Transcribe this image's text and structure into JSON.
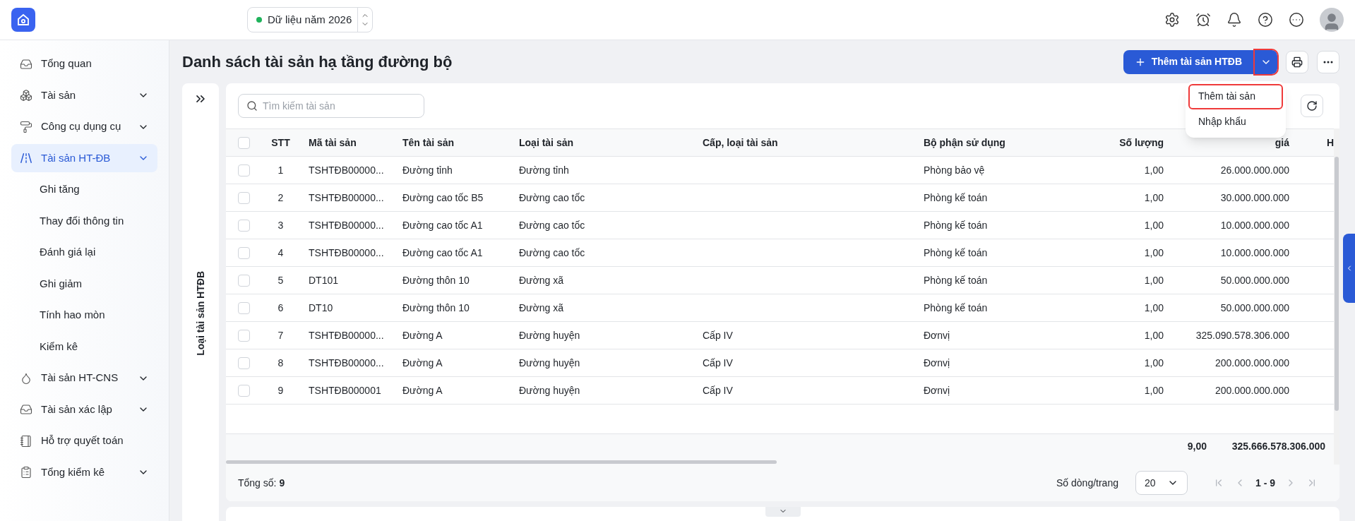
{
  "topbar": {
    "year_selector": "Dữ liệu năm 2026"
  },
  "sidebar": {
    "items": [
      {
        "label": "Tổng quan",
        "kind": "link",
        "selected": false
      },
      {
        "label": "Tài sản",
        "kind": "group",
        "selected": false
      },
      {
        "label": "Công cụ dụng cụ",
        "kind": "group",
        "selected": false
      },
      {
        "label": "Tài sản HT-ĐB",
        "kind": "group",
        "selected": true,
        "children": [
          {
            "label": "Ghi tăng",
            "selected": false
          },
          {
            "label": "Thay đổi thông tin",
            "selected": false
          },
          {
            "label": "Đánh giá lại",
            "selected": false
          },
          {
            "label": "Ghi giảm",
            "selected": false
          },
          {
            "label": "Tính hao mòn",
            "selected": false
          },
          {
            "label": "Kiểm kê",
            "selected": false
          }
        ]
      },
      {
        "label": "Tài sản HT-CNS",
        "kind": "group",
        "selected": false
      },
      {
        "label": "Tài sản xác lập",
        "kind": "group",
        "selected": false
      },
      {
        "label": "Hỗ trợ quyết toán",
        "kind": "link",
        "selected": false
      },
      {
        "label": "Tổng kiểm kê",
        "kind": "group",
        "selected": false
      }
    ]
  },
  "page": {
    "title": "Danh sách tài sản hạ tầng đường bộ",
    "add_button": "Thêm tài sản HTĐB",
    "add_menu_highlighted": true,
    "add_menu": [
      {
        "label": "Thêm tài sản",
        "selected": true
      },
      {
        "label": "Nhập khẩu",
        "selected": false
      }
    ]
  },
  "side_panel": {
    "title": "Loại tài sản HTĐB"
  },
  "search": {
    "placeholder": "Tìm kiếm tài sản"
  },
  "table": {
    "columns": [
      "STT",
      "Mã tài sản",
      "Tên tài sản",
      "Loại tài sản",
      "Cấp, loại tài sản",
      "Bộ phận sử dụng",
      "Số lượng",
      "giá",
      "H"
    ],
    "header_checked": false,
    "rows": [
      {
        "checked": false,
        "cells": [
          "1",
          "TSHTĐB00000...",
          "Đường tỉnh",
          "Đường tỉnh",
          "",
          "Phòng bảo vệ",
          "1,00",
          "26.000.000.000"
        ]
      },
      {
        "checked": false,
        "cells": [
          "2",
          "TSHTĐB00000...",
          "Đường cao tốc B5",
          "Đường cao tốc",
          "",
          "Phòng kế toán",
          "1,00",
          "30.000.000.000"
        ]
      },
      {
        "checked": false,
        "cells": [
          "3",
          "TSHTĐB00000...",
          "Đường cao tốc A1",
          "Đường cao tốc",
          "",
          "Phòng kế toán",
          "1,00",
          "10.000.000.000"
        ]
      },
      {
        "checked": false,
        "cells": [
          "4",
          "TSHTĐB00000...",
          "Đường cao tốc A1",
          "Đường cao tốc",
          "",
          "Phòng kế toán",
          "1,00",
          "10.000.000.000"
        ]
      },
      {
        "checked": false,
        "cells": [
          "5",
          "DT101",
          "Đường thôn 10",
          "Đường xã",
          "",
          "Phòng kế toán",
          "1,00",
          "50.000.000.000"
        ]
      },
      {
        "checked": false,
        "cells": [
          "6",
          "DT10",
          "Đường thôn 10",
          "Đường xã",
          "",
          "Phòng kế toán",
          "1,00",
          "50.000.000.000"
        ]
      },
      {
        "checked": false,
        "cells": [
          "7",
          "TSHTĐB00000...",
          "Đường A",
          "Đường huyện",
          "Cấp IV",
          "Đơnvị",
          "1,00",
          "325.090.578.306.000"
        ]
      },
      {
        "checked": false,
        "cells": [
          "8",
          "TSHTĐB00000...",
          "Đường A",
          "Đường huyện",
          "Cấp IV",
          "Đơnvị",
          "1,00",
          "200.000.000.000"
        ]
      },
      {
        "checked": false,
        "cells": [
          "9",
          "TSHTĐB000001",
          "Đường A",
          "Đường huyện",
          "Cấp IV",
          "Đơnvị",
          "1,00",
          "200.000.000.000"
        ]
      }
    ],
    "totals": [
      "9,00",
      "325.666.578.306.000"
    ]
  },
  "footer": {
    "total_label": "Tổng số:",
    "total_value": "9",
    "page_size_label": "Số dòng/trang",
    "page_size": "20",
    "range": "1 - 9"
  }
}
